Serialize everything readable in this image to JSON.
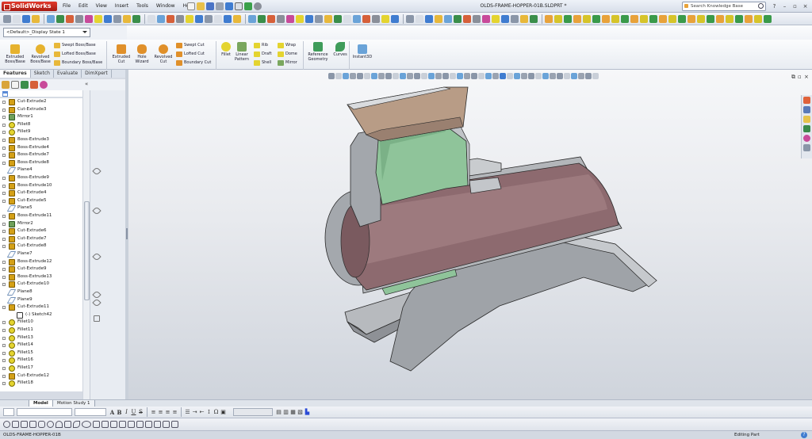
{
  "app": {
    "logo_text": "SolidWorks",
    "document_title": "OLDS-FRAME-HOPPER-01B.SLDPRT *",
    "menus": [
      "File",
      "Edit",
      "View",
      "Insert",
      "Tools",
      "Window",
      "Help"
    ],
    "search_placeholder": "Search Knowledge Base",
    "help_label": "?"
  },
  "config": {
    "selected": "<Default>_Display State 1"
  },
  "command_manager": {
    "extruded_boss": "Extruded\nBoss/Base",
    "revolved_boss": "Revolved\nBoss/Base",
    "swept_boss": "Swept Boss/Base",
    "lofted_boss": "Lofted Boss/Base",
    "boundary_boss": "Boundary Boss/Base",
    "extruded_cut": "Extruded\nCut",
    "hole_wizard": "Hole\nWizard",
    "revolved_cut": "Revolved\nCut",
    "swept_cut": "Swept Cut",
    "lofted_cut": "Lofted Cut",
    "boundary_cut": "Boundary Cut",
    "fillet": "Fillet",
    "linear_pattern": "Linear\nPattern",
    "rib": "Rib",
    "draft": "Draft",
    "shell": "Shell",
    "wrap": "Wrap",
    "dome": "Dome",
    "mirror": "Mirror",
    "reference_geometry": "Reference\nGeometry",
    "curves": "Curves",
    "instant3d": "Instant3D"
  },
  "feature_manager": {
    "tabs": [
      "Features",
      "Sketch",
      "Evaluate",
      "DimXpert"
    ],
    "collapse_glyph": "«",
    "tree": [
      {
        "label": "Cut-Extrude2",
        "type": "ext"
      },
      {
        "label": "Cut-Extrude3",
        "type": "ext"
      },
      {
        "label": "Mirror1",
        "type": "mirror"
      },
      {
        "label": "Fillet8",
        "type": "fillet"
      },
      {
        "label": "Fillet9",
        "type": "fillet"
      },
      {
        "label": "Boss-Extrude3",
        "type": "ext"
      },
      {
        "label": "Boss-Extrude4",
        "type": "ext"
      },
      {
        "label": "Boss-Extrude7",
        "type": "ext"
      },
      {
        "label": "Boss-Extrude8",
        "type": "ext"
      },
      {
        "label": "Plane4",
        "type": "plane"
      },
      {
        "label": "Boss-Extrude9",
        "type": "ext"
      },
      {
        "label": "Boss-Extrude10",
        "type": "ext"
      },
      {
        "label": "Cut-Extrude4",
        "type": "ext"
      },
      {
        "label": "Cut-Extrude5",
        "type": "ext"
      },
      {
        "label": "Plane5",
        "type": "plane"
      },
      {
        "label": "Boss-Extrude11",
        "type": "ext"
      },
      {
        "label": "Mirror2",
        "type": "mirror"
      },
      {
        "label": "Cut-Extrude6",
        "type": "ext"
      },
      {
        "label": "Cut-Extrude7",
        "type": "ext"
      },
      {
        "label": "Cut-Extrude8",
        "type": "ext"
      },
      {
        "label": "Plane7",
        "type": "plane"
      },
      {
        "label": "Boss-Extrude12",
        "type": "ext"
      },
      {
        "label": "Cut-Extrude9",
        "type": "ext"
      },
      {
        "label": "Boss-Extrude13",
        "type": "ext"
      },
      {
        "label": "Cut-Extrude10",
        "type": "ext"
      },
      {
        "label": "Plane8",
        "type": "plane"
      },
      {
        "label": "Plane9",
        "type": "plane"
      },
      {
        "label": "Cut-Extrude11",
        "type": "ext"
      },
      {
        "label": "(-) Sketch42",
        "type": "sketch",
        "child": true
      },
      {
        "label": "Fillet10",
        "type": "fillet"
      },
      {
        "label": "Fillet11",
        "type": "fillet"
      },
      {
        "label": "Fillet13",
        "type": "fillet"
      },
      {
        "label": "Fillet14",
        "type": "fillet"
      },
      {
        "label": "Fillet15",
        "type": "fillet"
      },
      {
        "label": "Fillet16",
        "type": "fillet"
      },
      {
        "label": "Fillet17",
        "type": "fillet"
      },
      {
        "label": "Cut-Extrude12",
        "type": "ext"
      },
      {
        "label": "Fillet18",
        "type": "fillet"
      }
    ]
  },
  "bottom_tabs": [
    "Model",
    "Motion Study 1"
  ],
  "status": {
    "file_name": "OLDS-FRAME-HOPPER-01B",
    "mode": "Editing Part",
    "help_glyph": "?"
  },
  "view_controls": [
    "⧉",
    "▫",
    "×"
  ],
  "colors": {
    "bore": "#8d6a6f",
    "green_face": "#8fc49a",
    "body": "#b9bcc0",
    "hopper_flange": "#b89c86"
  }
}
